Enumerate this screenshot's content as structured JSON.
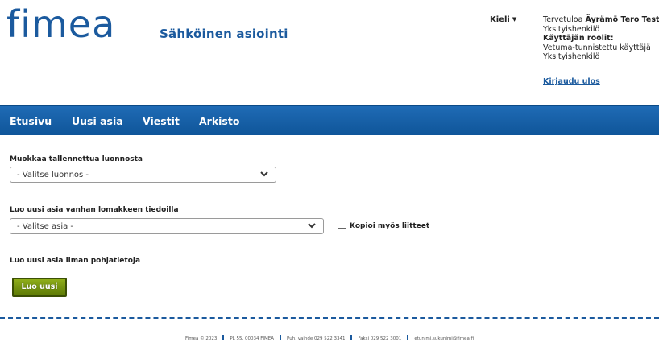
{
  "header": {
    "logo_text": "fimea",
    "site_title": "Sähköinen asiointi",
    "language_label": "Kieli",
    "user": {
      "welcome_prefix": "Tervetuloa",
      "user_name": "Äyrämö Tero Test",
      "user_type": "Yksityishenkilö",
      "roles_label": "Käyttäjän roolit:",
      "role_1": "Vetuma-tunnistettu käyttäjä",
      "role_2": "Yksityishenkilö"
    },
    "logout_label": "Kirjaudu ulos"
  },
  "nav": {
    "items": [
      {
        "label": "Etusivu"
      },
      {
        "label": "Uusi asia"
      },
      {
        "label": "Viestit"
      },
      {
        "label": "Arkisto"
      }
    ]
  },
  "main": {
    "draft_section": {
      "label": "Muokkaa tallennettua luonnosta",
      "select_value": "- Valitse luonnos -"
    },
    "old_form_section": {
      "label": "Luo uusi asia vanhan lomakkeen tiedoilla",
      "select_value": "- Valitse asia -",
      "checkbox_label": "Kopioi myös liitteet",
      "checkbox_checked": false
    },
    "blank_section": {
      "label": "Luo uusi asia ilman pohjatietoja",
      "button_label": "Luo uusi"
    }
  },
  "footer": {
    "copyright": "Fimea © 2023",
    "address": "PL 55, 00034 FIMEA",
    "phone": "Puh. vaihde 029 522 3341",
    "fax": "Faksi 029 522 3001",
    "email": "etunimi.sukunimi@fimea.fi"
  },
  "colors": {
    "brand_blue": "#1b5a9e",
    "nav_blue": "#1565b0",
    "button_green": "#6e8c0c"
  }
}
